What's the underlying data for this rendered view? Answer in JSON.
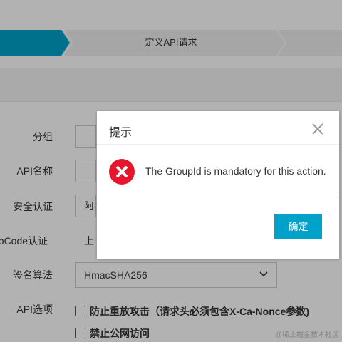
{
  "steps": {
    "current_label": "定义API请求"
  },
  "form": {
    "labels": {
      "group": "分组",
      "api_name": "API名称",
      "security_auth": "安全认证",
      "appcode_auth": "ppCode认证",
      "sign_algorithm": "签名算法",
      "api_options": "API选项"
    },
    "security_auth_value": "阿",
    "appcode_auth_value": "上",
    "sign_algorithm_value": "HmacSHA256",
    "options": [
      "防止重放攻击（请求头必须包含X-Ca-Nonce参数)",
      "禁止公网访问"
    ]
  },
  "dialog": {
    "title": "提示",
    "message": "The GroupId is mandatory for this action.",
    "ok_label": "确定"
  },
  "watermark": "@稀土掘金技术社区",
  "colors": {
    "accent": "#00a2ca",
    "error": "#e6162d",
    "overlay": "rgba(0,0,0,0.3)"
  }
}
